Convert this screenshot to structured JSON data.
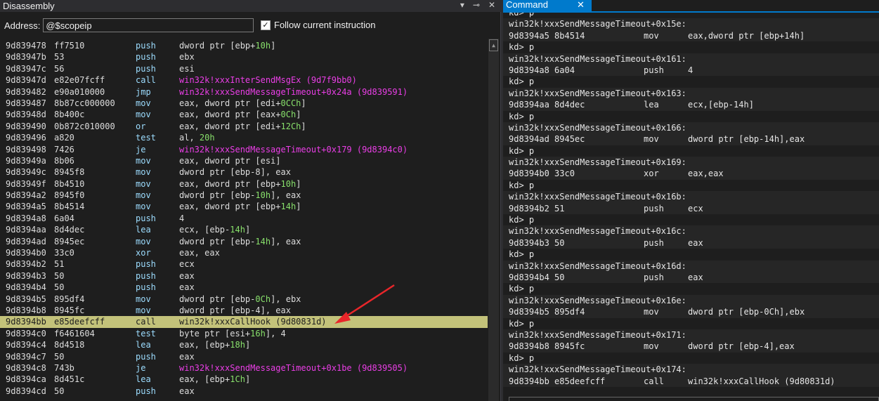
{
  "disassembly": {
    "title": "Disassembly",
    "icons": [
      "dropdown-icon",
      "pin-icon",
      "close-icon"
    ],
    "address_label": "Address:",
    "address_value": "@$scopeip",
    "follow_label": "Follow current instruction",
    "follow_checked": true,
    "current_index": 24,
    "rows": [
      {
        "addr": "9d839478",
        "bytes": "ff7510",
        "mn": "push",
        "op": "dword ptr [ebp+10h]",
        "num": "10h"
      },
      {
        "addr": "9d83947b",
        "bytes": "53",
        "mn": "push",
        "op": "ebx"
      },
      {
        "addr": "9d83947c",
        "bytes": "56",
        "mn": "push",
        "op": "esi"
      },
      {
        "addr": "9d83947d",
        "bytes": "e82e07fcff",
        "mn": "call",
        "op": "win32k!xxxInterSendMsgEx (9d7f9bb0)",
        "sym": true
      },
      {
        "addr": "9d839482",
        "bytes": "e90a010000",
        "mn": "jmp",
        "op": "win32k!xxxSendMessageTimeout+0x24a (9d839591)",
        "sym": true
      },
      {
        "addr": "9d839487",
        "bytes": "8b87cc000000",
        "mn": "mov",
        "op": "eax, dword ptr [edi+0CCh]",
        "num": "0CCh"
      },
      {
        "addr": "9d83948d",
        "bytes": "8b400c",
        "mn": "mov",
        "op": "eax, dword ptr [eax+0Ch]",
        "num": "0Ch"
      },
      {
        "addr": "9d839490",
        "bytes": "0b872c010000",
        "mn": "or",
        "op": "eax, dword ptr [edi+12Ch]",
        "num": "12Ch"
      },
      {
        "addr": "9d839496",
        "bytes": "a820",
        "mn": "test",
        "op": "al, 20h",
        "num": "20h"
      },
      {
        "addr": "9d839498",
        "bytes": "7426",
        "mn": "je",
        "op": "win32k!xxxSendMessageTimeout+0x179 (9d8394c0)",
        "sym": true
      },
      {
        "addr": "9d83949a",
        "bytes": "8b06",
        "mn": "mov",
        "op": "eax, dword ptr [esi]"
      },
      {
        "addr": "9d83949c",
        "bytes": "8945f8",
        "mn": "mov",
        "op": "dword ptr [ebp-8], eax"
      },
      {
        "addr": "9d83949f",
        "bytes": "8b4510",
        "mn": "mov",
        "op": "eax, dword ptr [ebp+10h]",
        "num": "10h"
      },
      {
        "addr": "9d8394a2",
        "bytes": "8945f0",
        "mn": "mov",
        "op": "dword ptr [ebp-10h], eax",
        "num": "10h"
      },
      {
        "addr": "9d8394a5",
        "bytes": "8b4514",
        "mn": "mov",
        "op": "eax, dword ptr [ebp+14h]",
        "num": "14h"
      },
      {
        "addr": "9d8394a8",
        "bytes": "6a04",
        "mn": "push",
        "op": "4"
      },
      {
        "addr": "9d8394aa",
        "bytes": "8d4dec",
        "mn": "lea",
        "op": "ecx, [ebp-14h]",
        "num": "14h"
      },
      {
        "addr": "9d8394ad",
        "bytes": "8945ec",
        "mn": "mov",
        "op": "dword ptr [ebp-14h], eax",
        "num": "14h"
      },
      {
        "addr": "9d8394b0",
        "bytes": "33c0",
        "mn": "xor",
        "op": "eax, eax"
      },
      {
        "addr": "9d8394b2",
        "bytes": "51",
        "mn": "push",
        "op": "ecx"
      },
      {
        "addr": "9d8394b3",
        "bytes": "50",
        "mn": "push",
        "op": "eax"
      },
      {
        "addr": "9d8394b4",
        "bytes": "50",
        "mn": "push",
        "op": "eax"
      },
      {
        "addr": "9d8394b5",
        "bytes": "895df4",
        "mn": "mov",
        "op": "dword ptr [ebp-0Ch], ebx",
        "num": "0Ch"
      },
      {
        "addr": "9d8394b8",
        "bytes": "8945fc",
        "mn": "mov",
        "op": "dword ptr [ebp-4], eax"
      },
      {
        "addr": "9d8394bb",
        "bytes": "e85deefcff",
        "mn": "call",
        "op": "win32k!xxxCallHook (9d80831d)"
      },
      {
        "addr": "9d8394c0",
        "bytes": "f6461604",
        "mn": "test",
        "op": "byte ptr [esi+16h], 4",
        "num": "16h"
      },
      {
        "addr": "9d8394c4",
        "bytes": "8d4518",
        "mn": "lea",
        "op": "eax, [ebp+18h]",
        "num": "18h"
      },
      {
        "addr": "9d8394c7",
        "bytes": "50",
        "mn": "push",
        "op": "eax"
      },
      {
        "addr": "9d8394c8",
        "bytes": "743b",
        "mn": "je",
        "op": "win32k!xxxSendMessageTimeout+0x1be (9d839505)",
        "sym": true
      },
      {
        "addr": "9d8394ca",
        "bytes": "8d451c",
        "mn": "lea",
        "op": "eax, [ebp+1Ch]",
        "num": "1Ch"
      },
      {
        "addr": "9d8394cd",
        "bytes": "50",
        "mn": "push",
        "op": "eax"
      }
    ]
  },
  "command": {
    "tab_label": "Command",
    "prompt": "kd> p",
    "blocks": [
      {
        "label": "win32k!xxxSendMessageTimeout+0x15e:",
        "ins": [
          "9d8394a5 8b4514",
          "mov",
          "eax,dword ptr [ebp+14h]"
        ]
      },
      {
        "label": "win32k!xxxSendMessageTimeout+0x161:",
        "ins": [
          "9d8394a8 6a04",
          "push",
          "4"
        ]
      },
      {
        "label": "win32k!xxxSendMessageTimeout+0x163:",
        "ins": [
          "9d8394aa 8d4dec",
          "lea",
          "ecx,[ebp-14h]"
        ]
      },
      {
        "label": "win32k!xxxSendMessageTimeout+0x166:",
        "ins": [
          "9d8394ad 8945ec",
          "mov",
          "dword ptr [ebp-14h],eax"
        ]
      },
      {
        "label": "win32k!xxxSendMessageTimeout+0x169:",
        "ins": [
          "9d8394b0 33c0",
          "xor",
          "eax,eax"
        ]
      },
      {
        "label": "win32k!xxxSendMessageTimeout+0x16b:",
        "ins": [
          "9d8394b2 51",
          "push",
          "ecx"
        ]
      },
      {
        "label": "win32k!xxxSendMessageTimeout+0x16c:",
        "ins": [
          "9d8394b3 50",
          "push",
          "eax"
        ]
      },
      {
        "label": "win32k!xxxSendMessageTimeout+0x16d:",
        "ins": [
          "9d8394b4 50",
          "push",
          "eax"
        ]
      },
      {
        "label": "win32k!xxxSendMessageTimeout+0x16e:",
        "ins": [
          "9d8394b5 895df4",
          "mov",
          "dword ptr [ebp-0Ch],ebx"
        ]
      },
      {
        "label": "win32k!xxxSendMessageTimeout+0x171:",
        "ins": [
          "9d8394b8 8945fc",
          "mov",
          "dword ptr [ebp-4],eax"
        ]
      },
      {
        "label": "win32k!xxxSendMessageTimeout+0x174:",
        "ins": [
          "9d8394bb e85deefcff",
          "call",
          "win32k!xxxCallHook (9d80831d)"
        ]
      }
    ]
  },
  "colors": {
    "accent": "#007acc",
    "current_line": "#c3c27a",
    "symbol": "#ea3ee6",
    "number": "#88e06b",
    "annotation_arrow": "#e8262a"
  }
}
